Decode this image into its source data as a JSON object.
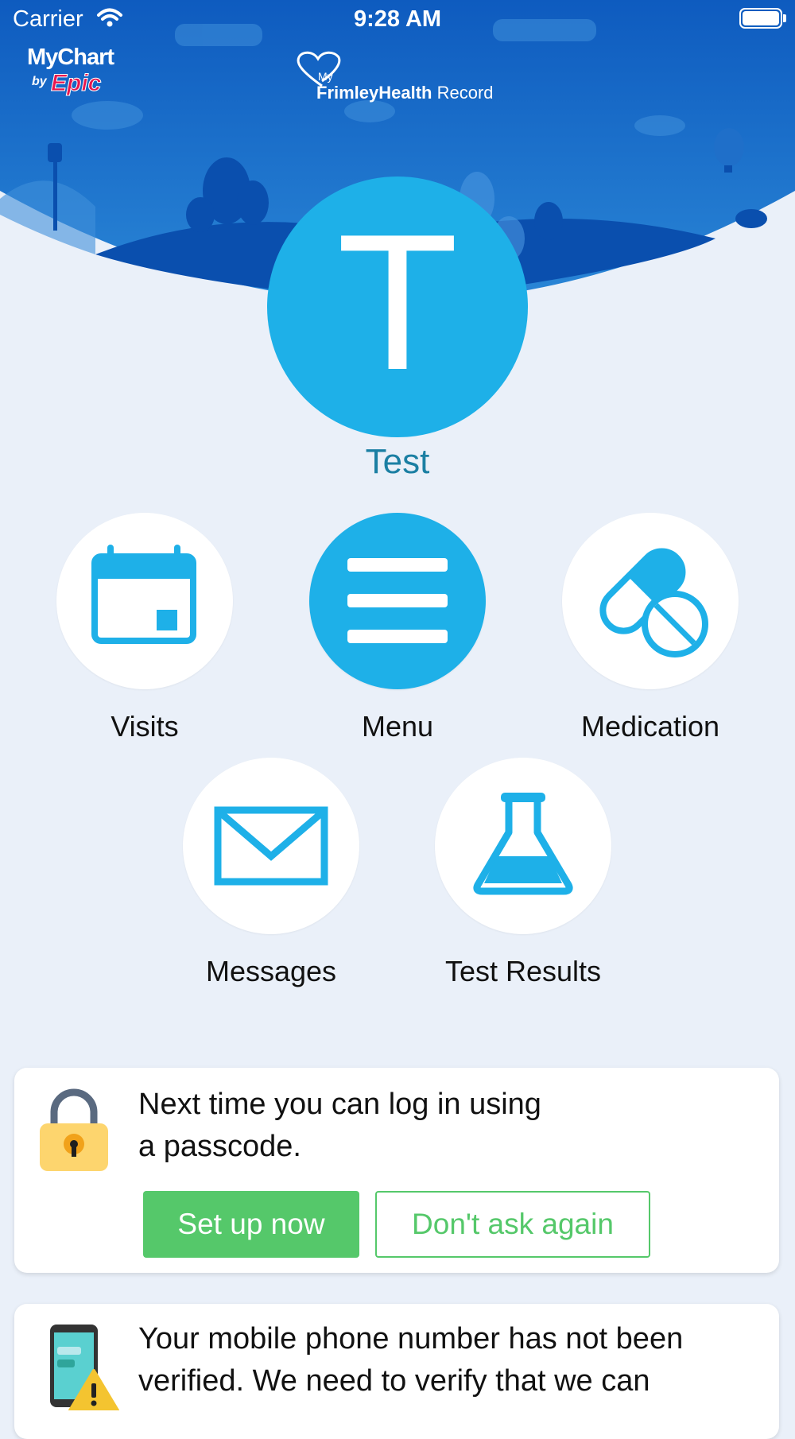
{
  "status_bar": {
    "carrier": "Carrier",
    "time": "9:28 AM"
  },
  "header": {
    "mychart_logo": {
      "line1": "MyChart",
      "by": "by",
      "epic": "Epic"
    },
    "org_logo": {
      "my": "My",
      "name_bold": "FrimleyHealth",
      "name_regular": " Record"
    }
  },
  "profile": {
    "initial": "T",
    "name": "Test"
  },
  "shortcuts": [
    {
      "label": "Visits",
      "icon": "calendar-icon"
    },
    {
      "label": "Menu",
      "icon": "menu-icon"
    },
    {
      "label": "Medication",
      "icon": "pills-icon"
    },
    {
      "label": "Messages",
      "icon": "envelope-icon"
    },
    {
      "label": "Test Results",
      "icon": "flask-icon"
    }
  ],
  "passcode_card": {
    "line1": "Next time you can log in using",
    "line2": "a passcode.",
    "setup_label": "Set up now",
    "dismiss_label": "Don't ask again"
  },
  "phone_card": {
    "line1": "Your mobile phone number has not been",
    "line2": "verified. We need to verify that we can"
  },
  "colors": {
    "brand_blue": "#1eb0e8",
    "header_blue": "#1565c0",
    "accent_green": "#55c86a"
  }
}
